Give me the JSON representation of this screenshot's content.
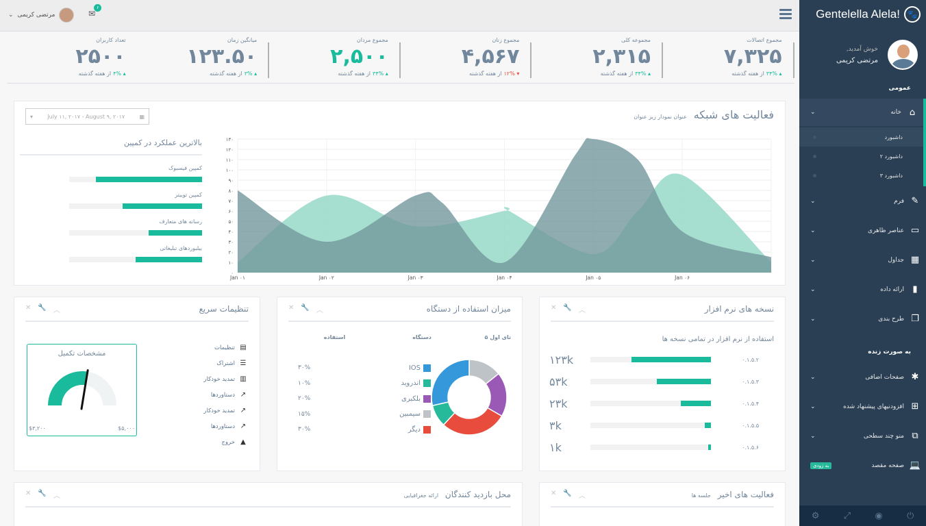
{
  "brand": {
    "name": "Gentelella Alela!"
  },
  "profile": {
    "welcome": "خوش آمدید,",
    "name": "مرتضی کریمی"
  },
  "menu": {
    "section1": "عمومی",
    "home": "خانه",
    "sub": [
      "داشبورد",
      "داشبورد ۲",
      "داشبورد ۳"
    ],
    "items": [
      "فرم",
      "عناصر ظاهری",
      "جداول",
      "ارائه داده",
      "طرح بندی"
    ],
    "section2": "به صورت زنده",
    "items2": [
      "صفحات اضافی",
      "افزودنیهای پیشنهاد شده",
      "منو چند سطحی",
      "صفحه مقصد"
    ],
    "badge": "به زودی"
  },
  "topnav": {
    "user": "مرتضی کریمی",
    "mail_count": "۶"
  },
  "tiles": [
    {
      "label": "تعداد کاربران",
      "value": "۲۵۰۰",
      "delta": "۴%",
      "dir": "g",
      "suffix": "از هفته گذشته",
      "green": false
    },
    {
      "label": "میانگین زمان",
      "value": "۱۲۳.۵۰",
      "delta": "۳%",
      "dir": "g",
      "suffix": "از هفته گذشته",
      "green": false
    },
    {
      "label": "مجموع مردان",
      "value": "۲,۵۰۰",
      "delta": "۳۴%",
      "dir": "g",
      "suffix": "از هفته گذشته",
      "green": true
    },
    {
      "label": "مجموع زنان",
      "value": "۴,۵۶۷",
      "delta": "۱۲%",
      "dir": "r",
      "suffix": "از هفته گذشته",
      "green": false
    },
    {
      "label": "مجموعه کلی",
      "value": "۲,۳۱۵",
      "delta": "۳۴%",
      "dir": "g",
      "suffix": "از هفته گذشته",
      "green": false
    },
    {
      "label": "مجموع اتصالات",
      "value": "۷,۳۲۵",
      "delta": "۳۴%",
      "dir": "g",
      "suffix": "از هفته گذشته",
      "green": false
    }
  ],
  "network": {
    "title": "فعالیت های شبکه",
    "subtitle": "عنوان نمودار زیر عنوان",
    "daterange": "July ۱۱, ۲۰۱۷ - August ۹, ۲۰۱۷",
    "campaign_title": "بالاترین عملکرد در کمپین",
    "campaigns": [
      {
        "label": "کمپین فیسبوک",
        "pct": 80
      },
      {
        "label": "کمپین توییتر",
        "pct": 60
      },
      {
        "label": "رسانه های متعارف",
        "pct": 40
      },
      {
        "label": "بیلبوردهای تبلیغاتی",
        "pct": 50
      }
    ]
  },
  "chart_data": {
    "type": "area",
    "categories": [
      "Jan ۰۱",
      "Jan ۰۲",
      "Jan ۰۳",
      "Jan ۰۴",
      "Jan ۰۵",
      "Jan ۰۶"
    ],
    "yticks": [
      "۰",
      "۱۰",
      "۲۰",
      "۳۰",
      "۴۰",
      "۵۰",
      "۶۰",
      "۷۰",
      "۸۰",
      "۹۰",
      "۱۰۰",
      "۱۱۰",
      "۱۲۰",
      "۱۳۰"
    ],
    "ylim": [
      0,
      130
    ],
    "xlim": [
      0,
      6
    ],
    "series": [
      {
        "color": "#96D8C8",
        "x": [
          0,
          1,
          2,
          3,
          3.05,
          4,
          4.5,
          5,
          6
        ],
        "y": [
          10,
          75,
          45,
          60,
          60,
          18,
          60,
          95,
          10
        ]
      },
      {
        "color": "#73979C",
        "x": [
          0,
          1,
          2,
          2.3,
          3,
          3.8,
          4,
          4.5,
          5,
          6
        ],
        "y": [
          80,
          30,
          75,
          68,
          10,
          115,
          130,
          110,
          40,
          15
        ]
      }
    ]
  },
  "software": {
    "title": "نسخه های نرم افزار",
    "subtitle": "استفاده از نرم افزار در تمامی نسخه ها",
    "rows": [
      {
        "ver": "۰.۱.۵.۲",
        "count": "۱۲۳k",
        "pct": 66
      },
      {
        "ver": "۰.۱.۵.۳",
        "count": "۵۳k",
        "pct": 45
      },
      {
        "ver": "۰.۱.۵.۴",
        "count": "۲۳k",
        "pct": 25
      },
      {
        "ver": "۰.۱.۵.۵",
        "count": "۳k",
        "pct": 5
      },
      {
        "ver": "۰.۱.۵.۶",
        "count": "۱k",
        "pct": 2
      }
    ]
  },
  "device": {
    "title": "میزان استفاده از دستگاه",
    "head": [
      "۵ تای اول",
      "دستگاه",
      "استفاده"
    ],
    "items": [
      {
        "name": "IOS",
        "pct": "۳۰%",
        "value": 30,
        "color": "#3498DB"
      },
      {
        "name": "اندروید",
        "pct": "۱۰%",
        "value": 10,
        "color": "#26B99A"
      },
      {
        "name": "بلکبری",
        "pct": "۲۰%",
        "value": 20,
        "color": "#9B59B6"
      },
      {
        "name": "سیمبین",
        "pct": "۱۵%",
        "value": 15,
        "color": "#BDC3C7"
      },
      {
        "name": "دیگر",
        "pct": "۳۰%",
        "value": 30,
        "color": "#E74C3C"
      }
    ]
  },
  "quick": {
    "title": "تنظیمات سریع",
    "items": [
      "تنظیمات",
      "اشتراک",
      "تمدید خودکار",
      "دستاوردها",
      "تمدید خودکار",
      "دستاوردها",
      "خروج"
    ],
    "gauge_title": "مشخصات تکمیل",
    "gauge_min": "$۳,۲۰۰",
    "gauge_max": "$۵,۰۰۰",
    "gauge_value": 0.55
  },
  "geo": {
    "title": "محل بازدید کنندگان",
    "subtitle": "ارائه جغرافیایی"
  },
  "activity": {
    "title": "فعالیت های اخیر",
    "subtitle": "جلسه ها"
  }
}
